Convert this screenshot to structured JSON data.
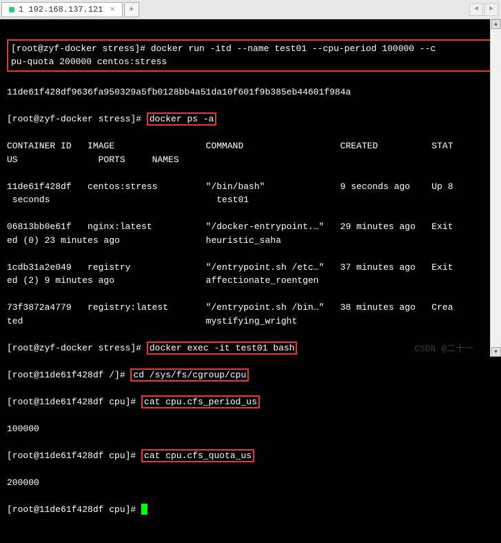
{
  "tab": {
    "title": "1 192.168.137.121",
    "close": "×",
    "add": "+"
  },
  "nav": {
    "prev": "◄",
    "next": "►"
  },
  "cmd1_full": "[root@zyf-docker stress]# docker run -itd --name test01 --cpu-period 100000 --cpu-quota 200000 centos:stress",
  "out1": "11de61f428df9636fa950329a5fb0128bb4a51da10f601f9b385eb44601f984a",
  "p2": "[root@zyf-docker stress]# ",
  "cmd2": "docker ps -a",
  "hdr": "CONTAINER ID   IMAGE                 COMMAND                  CREATED          STATUS               PORTS     NAMES",
  "r1": "11de61f428df   centos:stress         \"/bin/bash\"              9 seconds ago    Up 8 seconds                               test01",
  "r2": "06813bb0e61f   nginx:latest          \"/docker-entrypoint.…\"   29 minutes ago   Exited (0) 23 minutes ago                heuristic_saha",
  "r3": "1cdb31a2e049   registry              \"/entrypoint.sh /etc…\"   37 minutes ago   Exited (2) 9 minutes ago                 affectionate_roentgen",
  "r4": "73f3872a4779   registry:latest       \"/entrypoint.sh /bin…\"   38 minutes ago   Created                                  mystifying_wright",
  "p3": "[root@zyf-docker stress]# ",
  "cmd3": "docker exec -it test01 bash",
  "p4": "[root@11de61f428df /]# ",
  "cmd4": "cd /sys/fs/cgroup/cpu",
  "p5": "[root@11de61f428df cpu]# ",
  "cmd5": "cat cpu.cfs_period_us",
  "out5": "100000",
  "p6": "[root@11de61f428df cpu]# ",
  "cmd6": "cat cpu.cfs_quota_us",
  "out6": "200000",
  "p7": "[root@11de61f428df cpu]# ",
  "watermark": "CSDN @二十一"
}
